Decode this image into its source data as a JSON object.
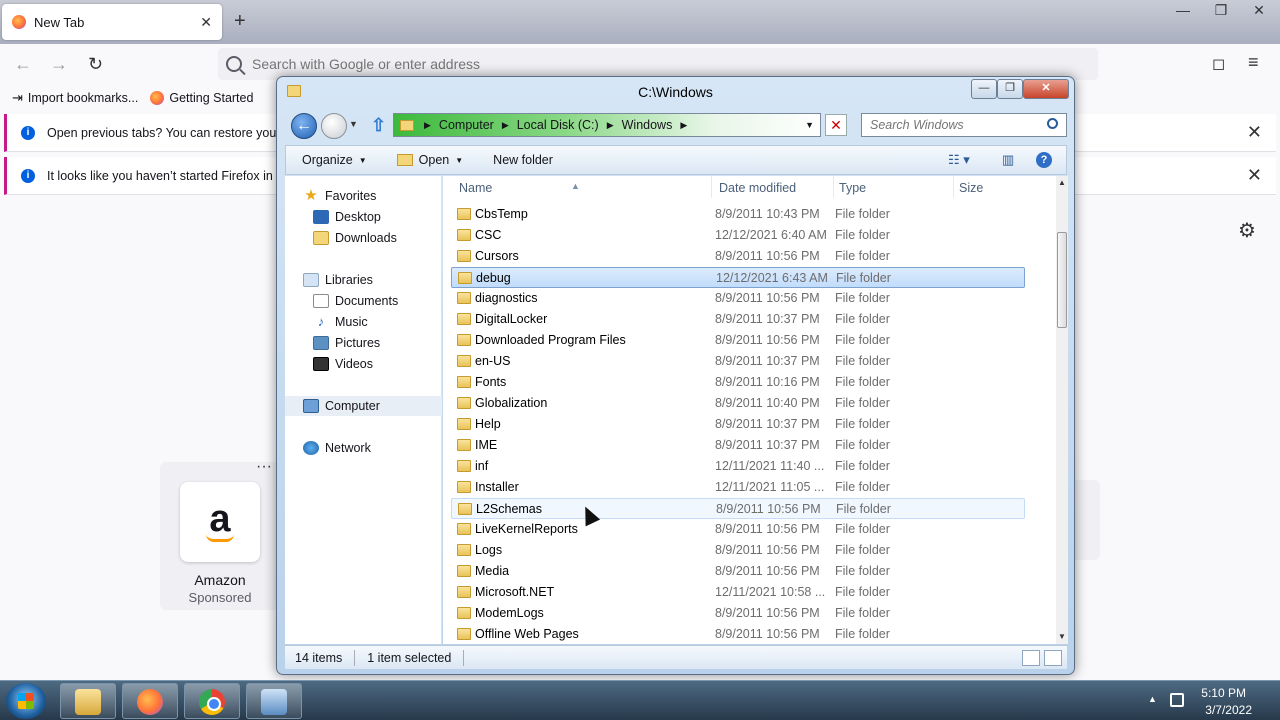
{
  "firefox": {
    "tab_title": "New Tab",
    "tab_close": "✕",
    "new_tab": "+",
    "window_controls": [
      "—",
      "❐",
      "✕"
    ],
    "url_placeholder": "Search with Google or enter address",
    "bookmarks": [
      "Import bookmarks...",
      "Getting Started"
    ],
    "notifications": [
      "Open previous tabs? You can restore your pr",
      "It looks like you haven’t started Firefox in a w"
    ],
    "shortcut": {
      "name": "Amazon",
      "sponsored": "Sponsored",
      "logo": "a"
    },
    "icons": {
      "back": "←",
      "forward": "→",
      "reload": "↻",
      "pocket": "◻",
      "menu": "≡",
      "settings": "⚙",
      "more": "···"
    }
  },
  "explorer": {
    "title": "C:\\Windows",
    "breadcrumbs": [
      "Computer",
      "Local Disk (C:)",
      "Windows"
    ],
    "search_placeholder": "Search Windows",
    "toolbar": {
      "organize": "Organize",
      "open": "Open",
      "new_folder": "New folder"
    },
    "nav_pane": {
      "favorites": "Favorites",
      "favorites_items": [
        "Desktop",
        "Downloads"
      ],
      "libraries": "Libraries",
      "libraries_items": [
        "Documents",
        "Music",
        "Pictures",
        "Videos"
      ],
      "computer": "Computer",
      "network": "Network"
    },
    "columns": [
      "Name",
      "Date modified",
      "Type",
      "Size"
    ],
    "files": [
      {
        "name": "CbsTemp",
        "date": "8/9/2011 10:43 PM",
        "type": "File folder"
      },
      {
        "name": "CSC",
        "date": "12/12/2021 6:40 AM",
        "type": "File folder"
      },
      {
        "name": "Cursors",
        "date": "8/9/2011 10:56 PM",
        "type": "File folder"
      },
      {
        "name": "debug",
        "date": "12/12/2021 6:43 AM",
        "type": "File folder"
      },
      {
        "name": "diagnostics",
        "date": "8/9/2011 10:56 PM",
        "type": "File folder"
      },
      {
        "name": "DigitalLocker",
        "date": "8/9/2011 10:37 PM",
        "type": "File folder"
      },
      {
        "name": "Downloaded Program Files",
        "date": "8/9/2011 10:56 PM",
        "type": "File folder"
      },
      {
        "name": "en-US",
        "date": "8/9/2011 10:37 PM",
        "type": "File folder"
      },
      {
        "name": "Fonts",
        "date": "8/9/2011 10:16 PM",
        "type": "File folder"
      },
      {
        "name": "Globalization",
        "date": "8/9/2011 10:40 PM",
        "type": "File folder"
      },
      {
        "name": "Help",
        "date": "8/9/2011 10:37 PM",
        "type": "File folder"
      },
      {
        "name": "IME",
        "date": "8/9/2011 10:37 PM",
        "type": "File folder"
      },
      {
        "name": "inf",
        "date": "12/11/2021 11:40 ...",
        "type": "File folder"
      },
      {
        "name": "Installer",
        "date": "12/11/2021 11:05 ...",
        "type": "File folder"
      },
      {
        "name": "L2Schemas",
        "date": "8/9/2011 10:56 PM",
        "type": "File folder"
      },
      {
        "name": "LiveKernelReports",
        "date": "8/9/2011 10:56 PM",
        "type": "File folder"
      },
      {
        "name": "Logs",
        "date": "8/9/2011 10:56 PM",
        "type": "File folder"
      },
      {
        "name": "Media",
        "date": "8/9/2011 10:56 PM",
        "type": "File folder"
      },
      {
        "name": "Microsoft.NET",
        "date": "12/11/2021 10:58 ...",
        "type": "File folder"
      },
      {
        "name": "ModemLogs",
        "date": "8/9/2011 10:56 PM",
        "type": "File folder"
      },
      {
        "name": "Offline Web Pages",
        "date": "8/9/2011 10:56 PM",
        "type": "File folder"
      }
    ],
    "selected_file": "debug",
    "hovered_file": "L2Schemas",
    "status": {
      "items": "14 items",
      "selected": "1 item selected"
    }
  },
  "taskbar": {
    "apps": [
      "Windows Explorer",
      "Firefox",
      "Google Chrome",
      "Control Panel"
    ],
    "time": "5:10 PM",
    "date": "3/7/2022"
  },
  "colors": {
    "selection": "#c1dcfc",
    "firefox_accent": "#c51a8a",
    "info_blue": "#0060df"
  }
}
